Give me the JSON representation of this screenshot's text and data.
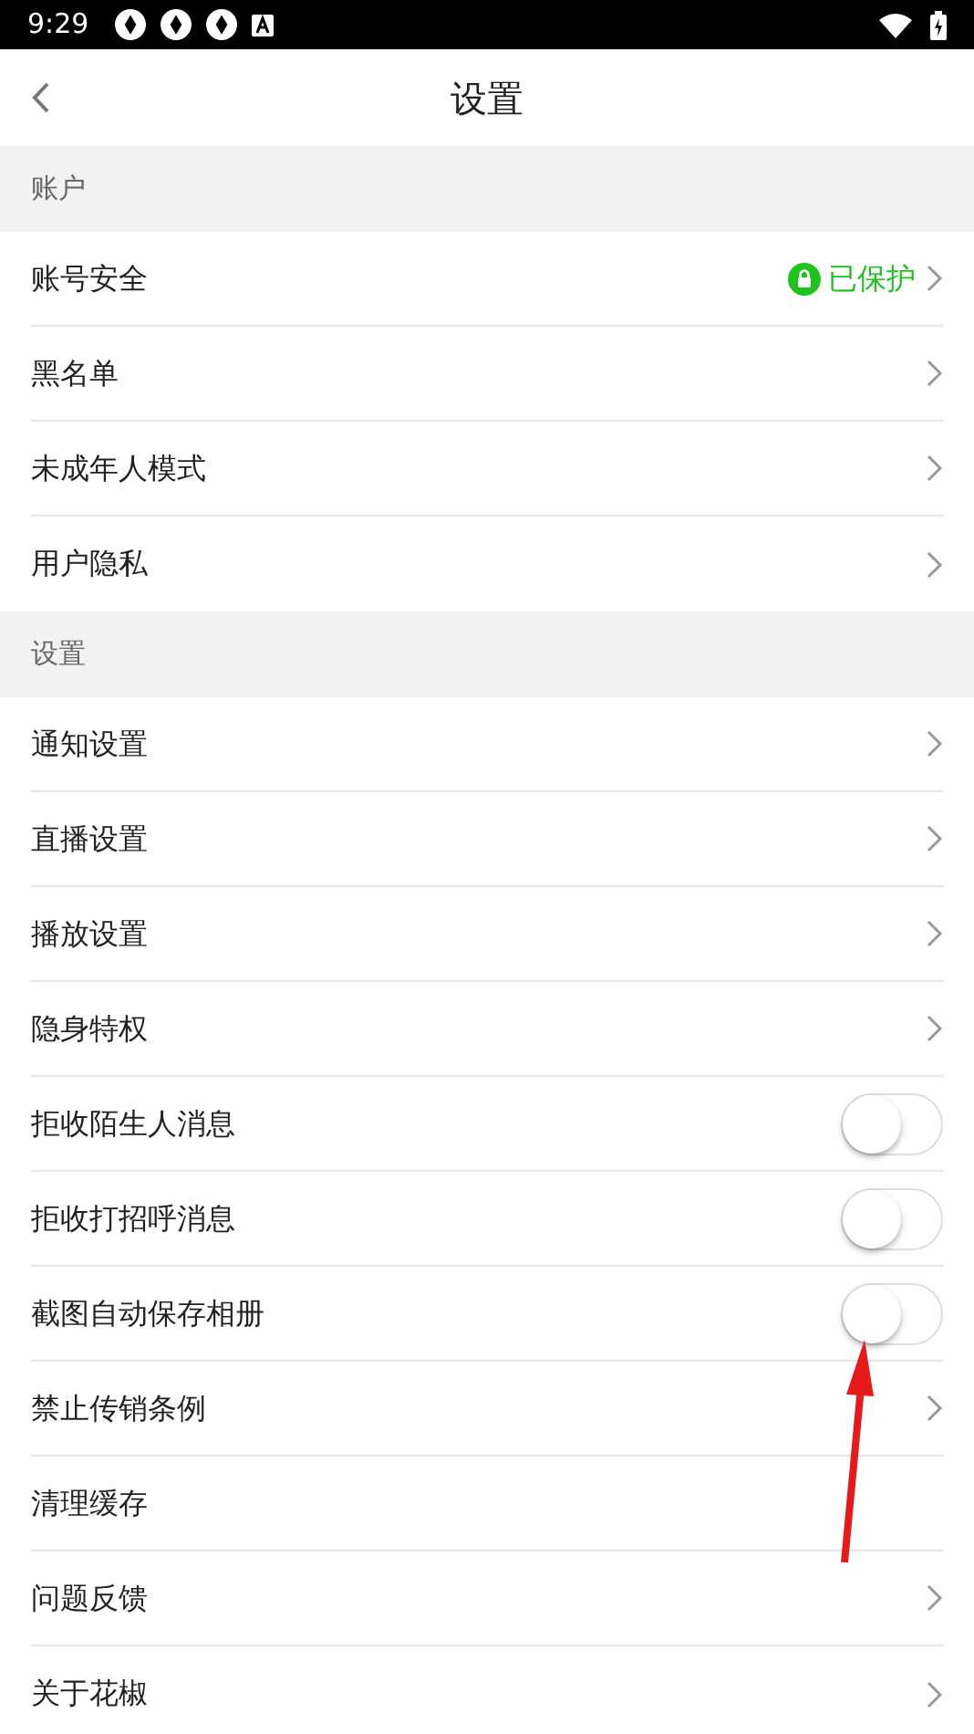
{
  "status_bar": {
    "time": "9:29"
  },
  "header": {
    "title": "设置"
  },
  "sections": [
    {
      "title": "账户",
      "items": [
        {
          "kind": "link",
          "label": "账号安全",
          "status": "已保护"
        },
        {
          "kind": "link",
          "label": "黑名单"
        },
        {
          "kind": "link",
          "label": "未成年人模式"
        },
        {
          "kind": "link",
          "label": "用户隐私"
        }
      ]
    },
    {
      "title": "设置",
      "items": [
        {
          "kind": "link",
          "label": "通知设置"
        },
        {
          "kind": "link",
          "label": "直播设置"
        },
        {
          "kind": "link",
          "label": "播放设置"
        },
        {
          "kind": "link",
          "label": "隐身特权"
        },
        {
          "kind": "toggle",
          "label": "拒收陌生人消息",
          "on": false
        },
        {
          "kind": "toggle",
          "label": "拒收打招呼消息",
          "on": false
        },
        {
          "kind": "toggle",
          "label": "截图自动保存相册",
          "on": false
        },
        {
          "kind": "link",
          "label": "禁止传销条例"
        },
        {
          "kind": "plain",
          "label": "清理缓存"
        },
        {
          "kind": "link",
          "label": "问题反馈"
        },
        {
          "kind": "link",
          "label": "关于花椒"
        }
      ]
    }
  ]
}
